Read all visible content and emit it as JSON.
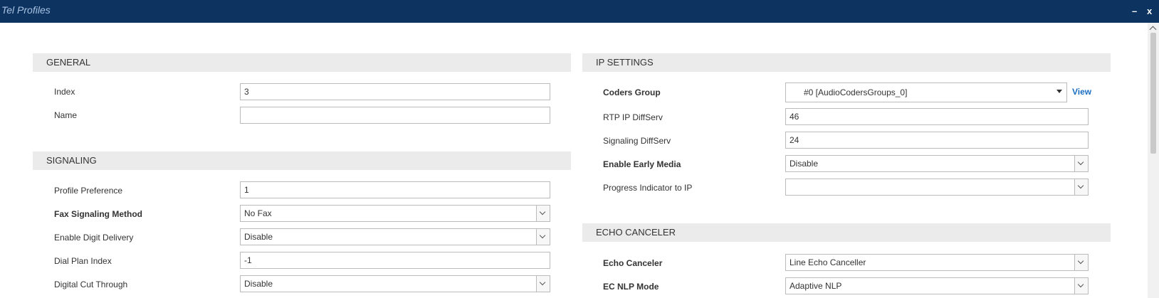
{
  "window": {
    "title": "Tel Profiles",
    "minimize_label": "–",
    "close_label": "x"
  },
  "general": {
    "header": "GENERAL",
    "index_label": "Index",
    "index_value": "3",
    "name_label": "Name",
    "name_value": ""
  },
  "signaling": {
    "header": "SIGNALING",
    "profile_preference_label": "Profile Preference",
    "profile_preference_value": "1",
    "fax_signaling_label": "Fax Signaling Method",
    "fax_signaling_value": "No Fax",
    "digit_delivery_label": "Enable Digit Delivery",
    "digit_delivery_value": "Disable",
    "dial_plan_label": "Dial Plan Index",
    "dial_plan_value": "-1",
    "cut_through_label": "Digital Cut Through",
    "cut_through_value": "Disable"
  },
  "ip_settings": {
    "header": "IP SETTINGS",
    "coders_group_label": "Coders Group",
    "coders_group_value": "#0 [AudioCodersGroups_0]",
    "view_link": "View",
    "rtp_diffserv_label": "RTP IP DiffServ",
    "rtp_diffserv_value": "46",
    "signaling_diffserv_label": "Signaling DiffServ",
    "signaling_diffserv_value": "24",
    "early_media_label": "Enable Early Media",
    "early_media_value": "Disable",
    "progress_indicator_label": "Progress Indicator to IP",
    "progress_indicator_value": ""
  },
  "echo_canceler": {
    "header": "ECHO CANCELER",
    "echo_canceler_label": "Echo Canceler",
    "echo_canceler_value": "Line Echo Canceller",
    "ec_nlp_label": "EC NLP Mode",
    "ec_nlp_value": "Adaptive NLP"
  },
  "colors": {
    "titlebar": "#0d3361",
    "section_header_bg": "#ebebeb",
    "link": "#1b6fc2"
  }
}
